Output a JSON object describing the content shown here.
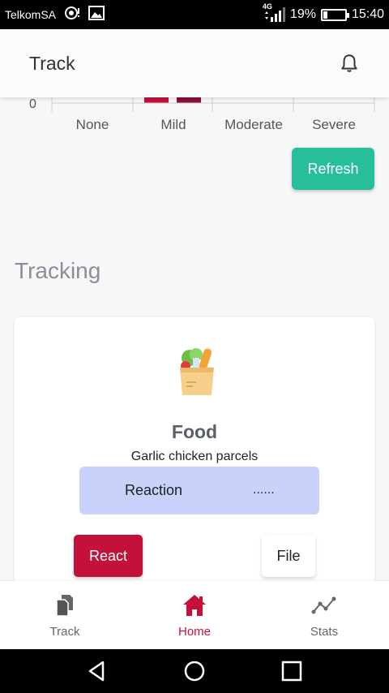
{
  "status_bar": {
    "carrier": "TelkomSA",
    "network": "4G",
    "battery_percent": "19%",
    "battery_level": 0.19,
    "time": "15:40"
  },
  "app_bar": {
    "title": "Track",
    "notification_icon": "bell-icon"
  },
  "chart_data": {
    "type": "bar",
    "categories": [
      "None",
      "Mild",
      "Moderate",
      "Severe"
    ],
    "y_tick_labels": [
      "0"
    ],
    "colors": [
      "#c4113a",
      "#8b0f36"
    ]
  },
  "actions": {
    "refresh_label": "Refresh"
  },
  "tracking": {
    "section_title": "Tracking",
    "card": {
      "icon": "grocery-bag-icon",
      "title": "Food",
      "subtitle": "Garlic chicken parcels",
      "reaction_label": "Reaction",
      "reaction_value": "......",
      "react_label": "React",
      "file_label": "File"
    }
  },
  "bottom_nav": {
    "items": [
      {
        "label": "Track",
        "icon": "documents-icon",
        "active": false
      },
      {
        "label": "Home",
        "icon": "home-icon",
        "active": true
      },
      {
        "label": "Stats",
        "icon": "line-chart-icon",
        "active": false
      }
    ]
  },
  "colors": {
    "accent": "#c4113a",
    "refresh": "#26bf99",
    "reaction_box": "#c8d2fb"
  }
}
